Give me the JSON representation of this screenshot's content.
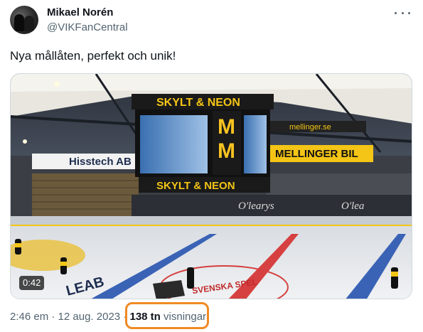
{
  "author": {
    "display_name": "Mikael Norén",
    "handle": "@VIKFanCentral"
  },
  "tweet": {
    "text": "Nya mållåten, perfekt och unik!"
  },
  "video": {
    "duration": "0:42",
    "scene_text": {
      "banner_left": "Hisstech AB",
      "banner_right": "MELLINGER BIL",
      "banner_top": "mellinger.se",
      "cube_top": "SKYLT & NEON",
      "cube_bottom": "SKYLT & NEON",
      "board_1": "O'learys",
      "board_2": "O'lea",
      "ice_logo": "SVENSKA SPEL",
      "rink_text": "LEAB"
    }
  },
  "meta": {
    "time": "2:46 em",
    "separator": "·",
    "date": "12 aug. 2023",
    "views_count": "138 tn",
    "views_label": "visningar"
  },
  "colors": {
    "highlight": "#f08a24",
    "secondary_text": "#536471",
    "primary_text": "#0f1419"
  }
}
